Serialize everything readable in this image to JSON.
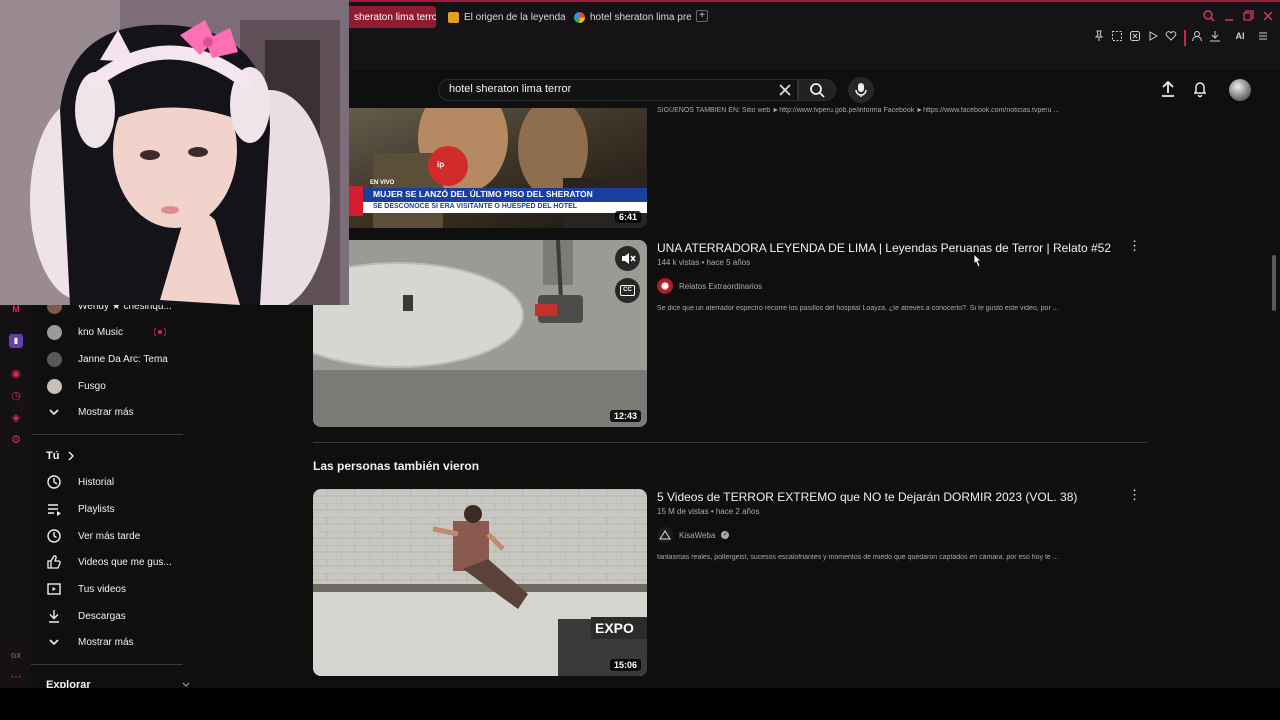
{
  "browser": {
    "tabs": [
      {
        "label": "sheraton lima terror",
        "active": true
      },
      {
        "label": "El origen de la leyenda de",
        "active": false
      },
      {
        "label": "hotel sheraton lima precio",
        "active": false
      }
    ],
    "new_tab": "+",
    "ai_label": "AI"
  },
  "search": {
    "query": "hotel sheraton lima terror"
  },
  "sidebar": {
    "subscriptions": [
      {
        "label": "Wendy ★ chesinqu...",
        "color": "#7a5a4a"
      },
      {
        "label": "kno Music",
        "color": "#9a9a9a",
        "live": true
      },
      {
        "label": "Janne Da Arc: Tema",
        "color": "#5a5a5a"
      },
      {
        "label": "Fusgo",
        "color": "#c8c0b8"
      }
    ],
    "show_more_1": "Mostrar más",
    "you_heading": "Tú",
    "you_items": [
      {
        "label": "Historial",
        "icon": "history-icon"
      },
      {
        "label": "Playlists",
        "icon": "playlists-icon"
      },
      {
        "label": "Ver más tarde",
        "icon": "watch-later-icon"
      },
      {
        "label": "Videos que me gus...",
        "icon": "liked-videos-icon"
      },
      {
        "label": "Tus videos",
        "icon": "your-videos-icon"
      },
      {
        "label": "Descargas",
        "icon": "downloads-icon"
      }
    ],
    "show_more_2": "Mostrar más",
    "explore_heading": "Explorar"
  },
  "results": {
    "first": {
      "description": "SIGUENOS TAMBIEN EN: Sitio web ►http://www.tvperu.gob.pe/informa Facebook ►https://www.facebook.com/noticias.tvperu ...",
      "duration": "6:41",
      "lower_third_tag": "EN VIVO",
      "lower_third_line1": "MUJER SE LANZÓ DEL ÚLTIMO PISO DEL SHERATON",
      "lower_third_line2": "SE DESCONOCE SI ERA VISITANTE O HUÉSPED DEL HOTEL",
      "channel_logo": "ip"
    },
    "second": {
      "title": "UNA ATERRADORA LEYENDA DE LIMA | Leyendas Peruanas de Terror | Relato #52",
      "views": "144 k vistas",
      "age": "hace 5 años",
      "channel": "Relatos Extraordinarios",
      "description": "Se dice que un aterrador espectro recorre los pasillos del hospital Loayza, ¿te atreves a conocerlo?. Si te gustó este video, por ...",
      "duration": "12:43",
      "cc_label": "CC"
    },
    "section_title": "Las personas también vieron",
    "third": {
      "title": "5 Videos de TERROR EXTREMO que NO te Dejarán DORMIR 2023 (VOL. 38)",
      "views": "15 M de vistas",
      "age": "hace 2 años",
      "channel": "KisaWeba",
      "verified": "✓",
      "description": "fantasmas reales, poltergeist, sucesos escalofriantes y momentos de miedo que quedaron captados en cámara. por eso hoy te ...",
      "duration": "15:06",
      "thumb_sign": "EXPO"
    }
  },
  "meta_sep": "•",
  "colors": {
    "accent": "#c3284d",
    "bg": "#0f0f0f"
  }
}
